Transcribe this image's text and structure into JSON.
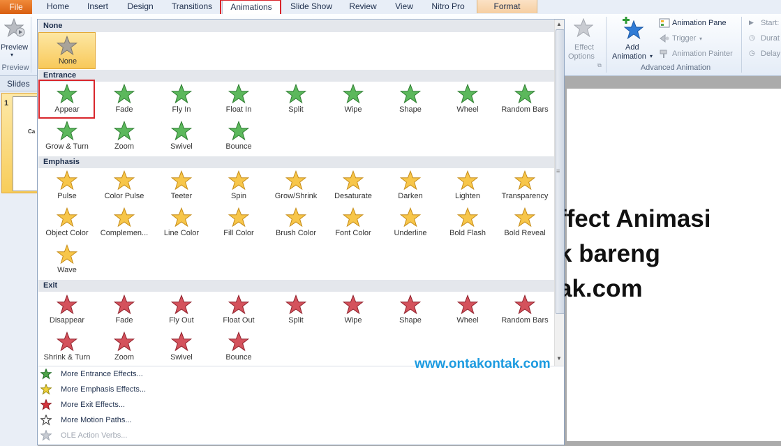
{
  "tabs": {
    "file": "File",
    "items": [
      "Home",
      "Insert",
      "Design",
      "Transitions",
      "Animations",
      "Slide Show",
      "Review",
      "View",
      "Nitro Pro",
      "Format"
    ],
    "active": "Animations"
  },
  "ribbon": {
    "preview_label": "Preview",
    "preview_group_label": "Preview",
    "effect_options_label": "Effect Options",
    "effect_options_line1": "Effect",
    "effect_options_line2": "Options",
    "add_animation_line1": "Add",
    "add_animation_line2": "Animation",
    "animation_pane": "Animation Pane",
    "trigger": "Trigger",
    "animation_painter": "Animation Painter",
    "advanced_group_label": "Advanced Animation",
    "start": "Start:",
    "duration": "Durat",
    "delay": "Delay"
  },
  "slides_pane": {
    "header": "Slides",
    "slide_number": "1",
    "thumb_text": "Ca"
  },
  "slide": {
    "line1": "ffect Animasi",
    "line2": "k bareng",
    "line3": "ak.com"
  },
  "watermark": "www.ontakontak.com",
  "gallery": {
    "none_section": "None",
    "none_effects": [
      "None"
    ],
    "entrance_section": "Entrance",
    "entrance_effects": [
      "Appear",
      "Fade",
      "Fly In",
      "Float In",
      "Split",
      "Wipe",
      "Shape",
      "Wheel",
      "Random Bars",
      "Grow & Turn",
      "Zoom",
      "Swivel",
      "Bounce"
    ],
    "emphasis_section": "Emphasis",
    "emphasis_effects": [
      "Pulse",
      "Color Pulse",
      "Teeter",
      "Spin",
      "Grow/Shrink",
      "Desaturate",
      "Darken",
      "Lighten",
      "Transparency",
      "Object Color",
      "Complemen...",
      "Line Color",
      "Fill Color",
      "Brush Color",
      "Font Color",
      "Underline",
      "Bold Flash",
      "Bold Reveal",
      "Wave"
    ],
    "exit_section": "Exit",
    "exit_effects": [
      "Disappear",
      "Fade",
      "Fly Out",
      "Float Out",
      "Split",
      "Wipe",
      "Shape",
      "Wheel",
      "Random Bars",
      "Shrink & Turn",
      "Zoom",
      "Swivel",
      "Bounce"
    ],
    "selected_effect": "Appear"
  },
  "menu": {
    "items": [
      "More Entrance Effects...",
      "More Emphasis Effects...",
      "More Exit Effects...",
      "More Motion Paths...",
      "OLE Action Verbs..."
    ],
    "disabled": [
      "OLE Action Verbs..."
    ]
  },
  "colors": {
    "entrance_green": "#4fa64a",
    "emphasis_gold": "#f2b733",
    "exit_red": "#c8414b",
    "highlight_red": "#d9262c",
    "watermark_blue": "#1d9be0"
  }
}
